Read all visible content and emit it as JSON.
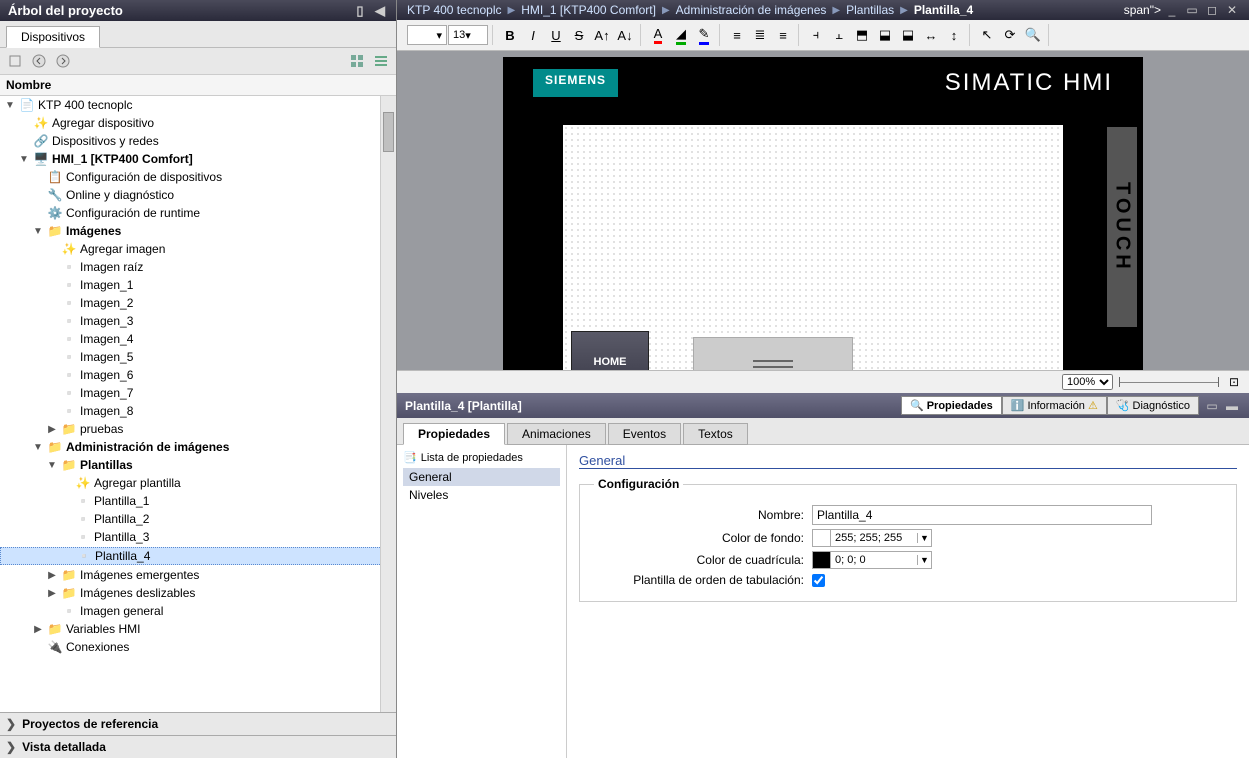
{
  "left_panel": {
    "title": "Árbol del proyecto",
    "tab": "Dispositivos",
    "tree_header": "Nombre",
    "footer1": "Proyectos de referencia",
    "footer2": "Vista detallada"
  },
  "tree": {
    "root": "KTP 400 tecnoplc",
    "add_device": "Agregar dispositivo",
    "devices_networks": "Dispositivos y redes",
    "hmi": "HMI_1 [KTP400 Comfort]",
    "dev_config": "Configuración de dispositivos",
    "online_diag": "Online y diagnóstico",
    "runtime_cfg": "Configuración de runtime",
    "images": "Imágenes",
    "add_image": "Agregar imagen",
    "image_root": "Imagen raíz",
    "img1": "Imagen_1",
    "img2": "Imagen_2",
    "img3": "Imagen_3",
    "img4": "Imagen_4",
    "img5": "Imagen_5",
    "img6": "Imagen_6",
    "img7": "Imagen_7",
    "img8": "Imagen_8",
    "tests": "pruebas",
    "img_admin": "Administración de imágenes",
    "templates": "Plantillas",
    "add_tpl": "Agregar plantilla",
    "tpl1": "Plantilla_1",
    "tpl2": "Plantilla_2",
    "tpl3": "Plantilla_3",
    "tpl4": "Plantilla_4",
    "popup": "Imágenes emergentes",
    "slidein": "Imágenes deslizables",
    "general_img": "Imagen general",
    "hmi_vars": "Variables HMI",
    "connections": "Conexiones"
  },
  "breadcrumb": {
    "c1": "KTP 400 tecnoplc",
    "c2": "HMI_1 [KTP400 Comfort]",
    "c3": "Administración de imágenes",
    "c4": "Plantillas",
    "c5": "Plantilla_4"
  },
  "editor": {
    "font_size": "13",
    "zoom": "100%",
    "siemens": "SIEMENS",
    "simatic": "SIMATIC HMI",
    "touch": "TOUCH",
    "home_btn": "HOME"
  },
  "props": {
    "header_title": "Plantilla_4 [Plantilla]",
    "rtab_props": "Propiedades",
    "rtab_info": "Información",
    "rtab_diag": "Diagnóstico",
    "tab_props": "Propiedades",
    "tab_anim": "Animaciones",
    "tab_events": "Eventos",
    "tab_texts": "Textos",
    "nav_header": "Lista de propiedades",
    "nav_general": "General",
    "nav_levels": "Niveles",
    "section": "General",
    "fieldset": "Configuración",
    "lbl_name": "Nombre:",
    "val_name": "Plantilla_4",
    "lbl_bg": "Color de fondo:",
    "val_bg": "255; 255; 255",
    "lbl_grid": "Color de cuadrícula:",
    "val_grid": "0; 0; 0",
    "lbl_tab_order": "Plantilla de orden de tabulación:"
  }
}
